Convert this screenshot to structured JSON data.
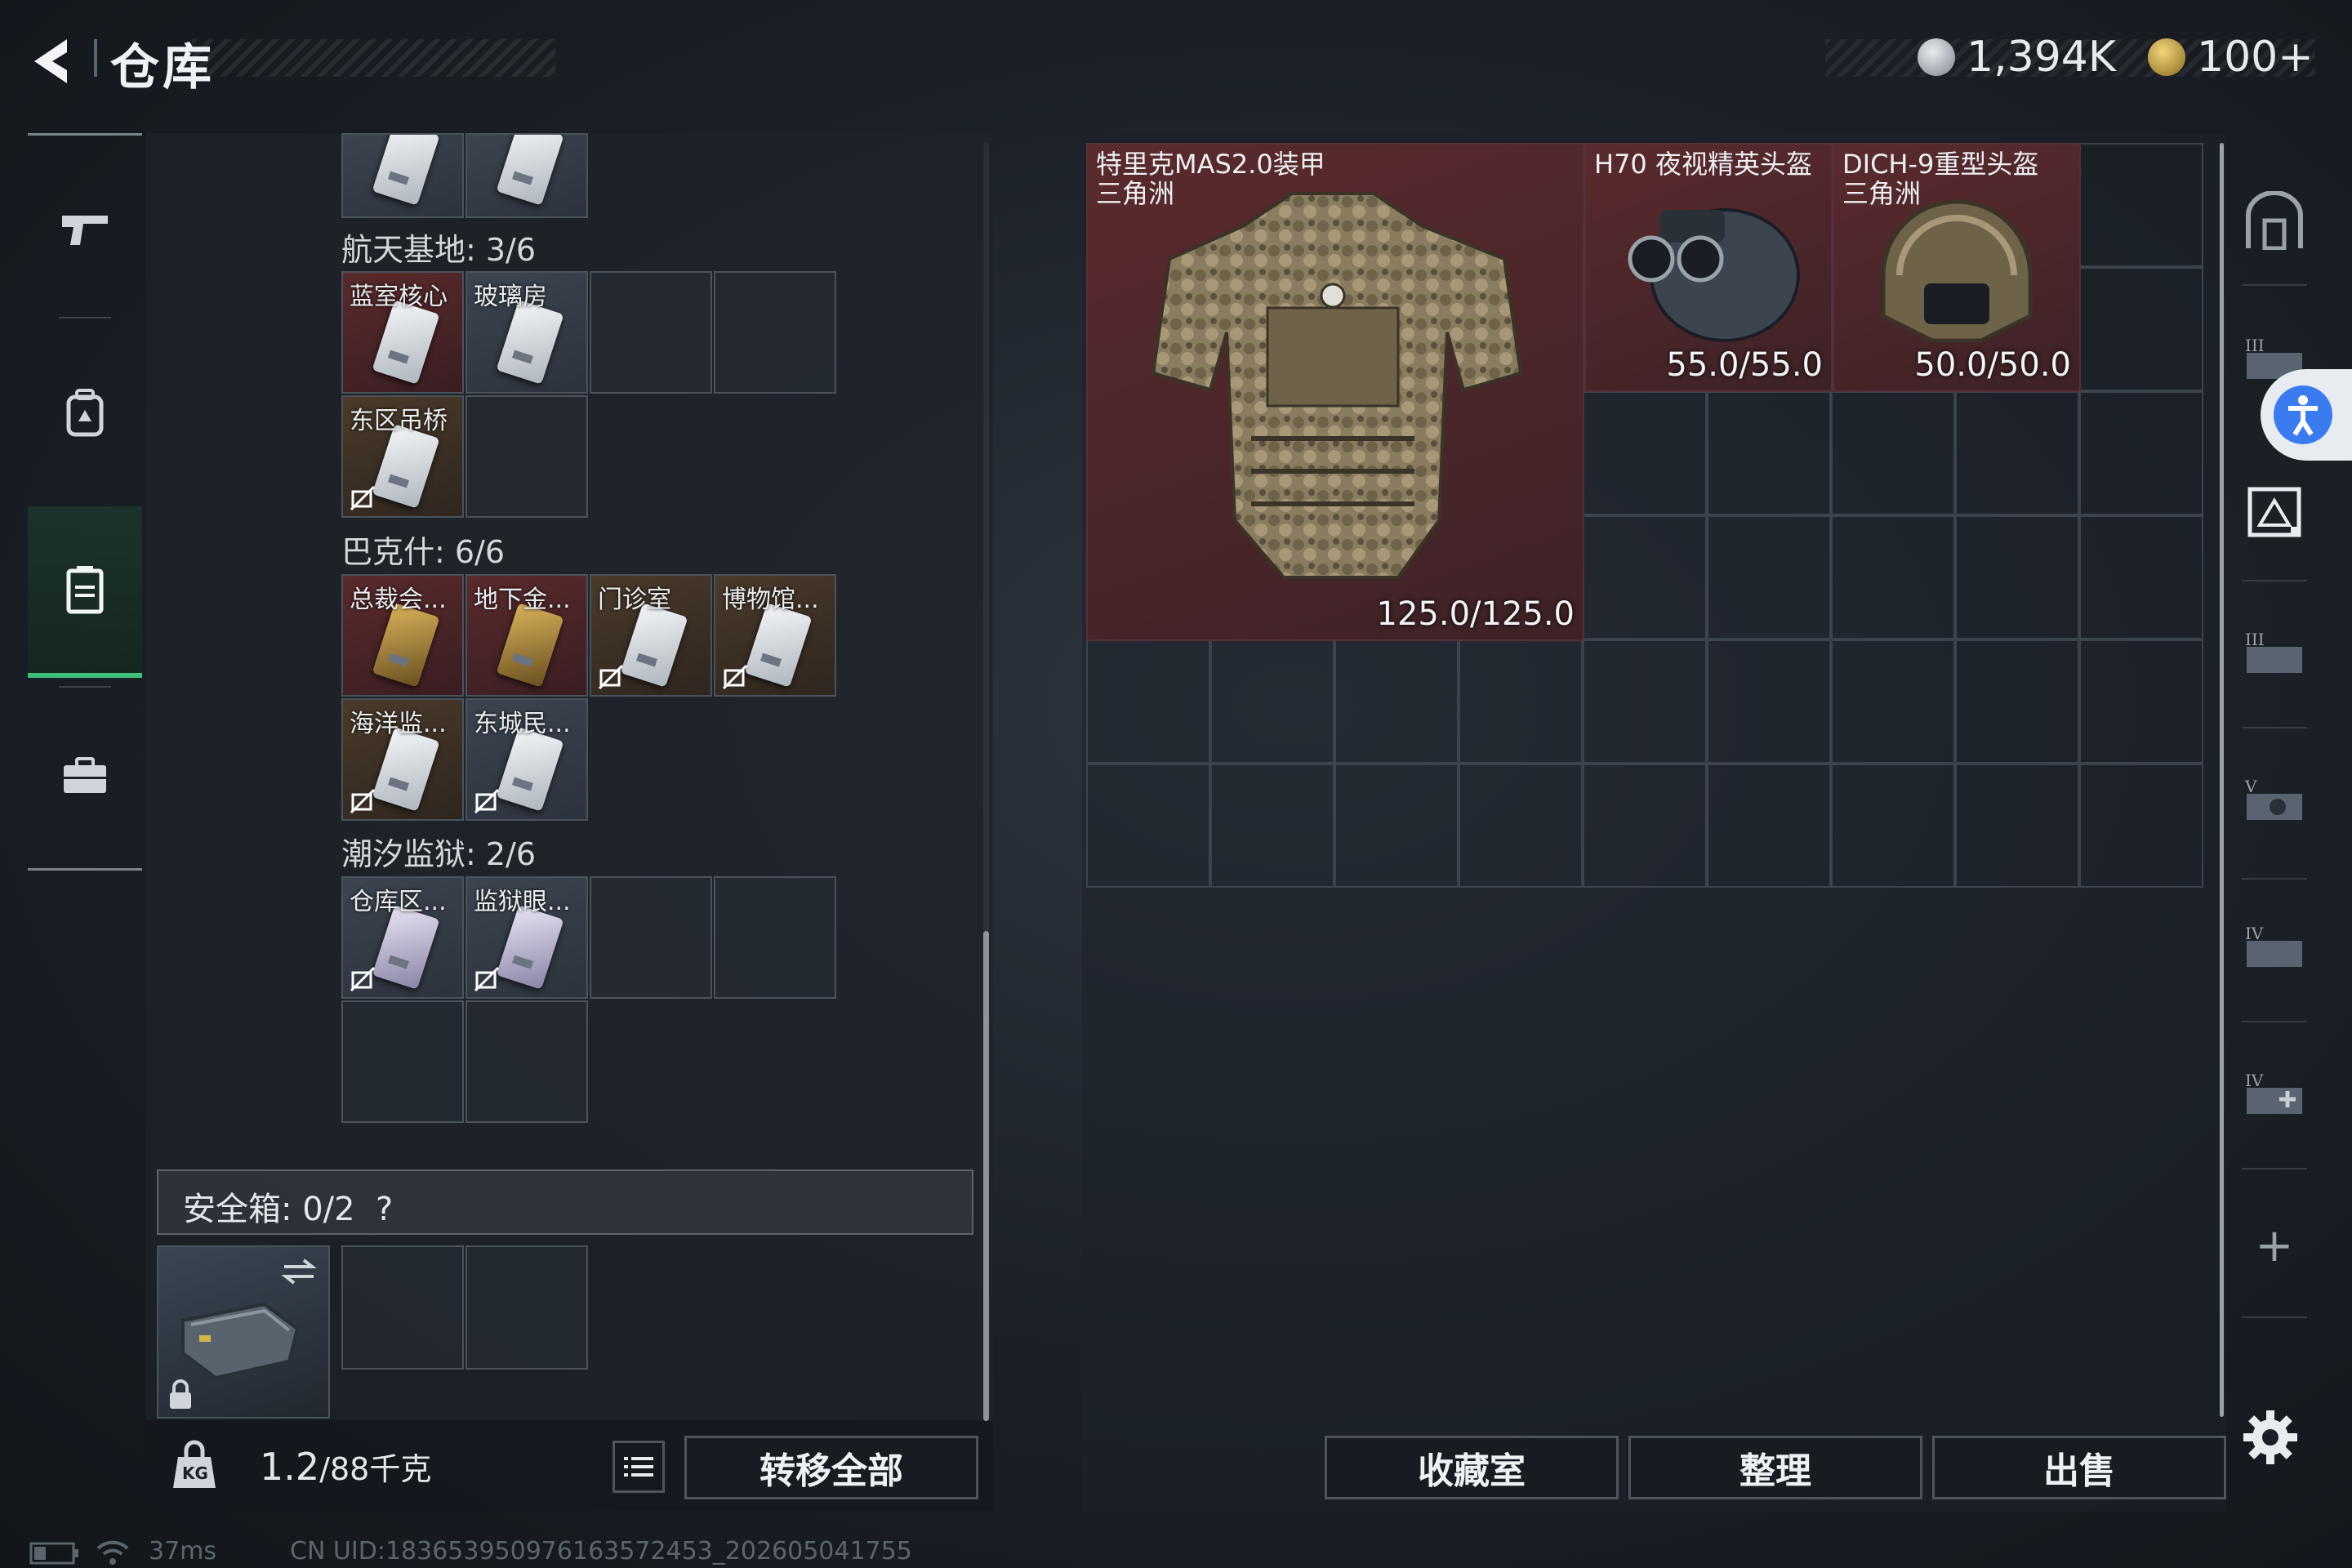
{
  "header": {
    "title": "仓库",
    "currency_1": "1,394K",
    "currency_2": "100+"
  },
  "left_nav": [
    "gun-icon",
    "backpack-icon",
    "locker-icon",
    "briefcase-icon"
  ],
  "keycard_sections": [
    {
      "label": "航天基地: 3/6"
    },
    {
      "label": "巴克什: 6/6"
    },
    {
      "label": "潮汐监狱: 2/6"
    }
  ],
  "keycards": {
    "a1": "蓝室核心",
    "a2": "玻璃房",
    "a3": "东区吊桥",
    "b1": "总裁会...",
    "b2": "地下金...",
    "b3": "门诊室",
    "b4": "博物馆...",
    "b5": "海洋监...",
    "b6": "东城民...",
    "c1": "仓库区...",
    "c2": "监狱眼..."
  },
  "safe_box": {
    "label": "安全箱:  0/2",
    "help": "?"
  },
  "weight": {
    "value": "1.2",
    "max": "/88千克",
    "kg_badge": "KG"
  },
  "buttons": {
    "transfer_all": "转移全部",
    "collection": "收藏室",
    "sort": "整理",
    "sell": "出售"
  },
  "stash_items": [
    {
      "name_line1": "特里克MAS2.0装甲",
      "name_line2": "三角洲",
      "durability": "125.0/125.0"
    },
    {
      "name_line1": "H70 夜视精英头盔",
      "name_line2": "",
      "durability": "55.0/55.0"
    },
    {
      "name_line1": "DICH-9重型头盔",
      "name_line2": "三角洲",
      "durability": "50.0/50.0"
    }
  ],
  "right_rail": {
    "plus": "+",
    "labels": [
      "III",
      "III",
      "V",
      "IV",
      "IV"
    ]
  },
  "status_bar": {
    "ping": "37ms",
    "uid": "CN UID:18365395097616357245​3_202605041755"
  },
  "colors": {
    "accent_green": "#3ec07a",
    "item_red": "#5a2a2e",
    "panel": "#1e232a"
  }
}
